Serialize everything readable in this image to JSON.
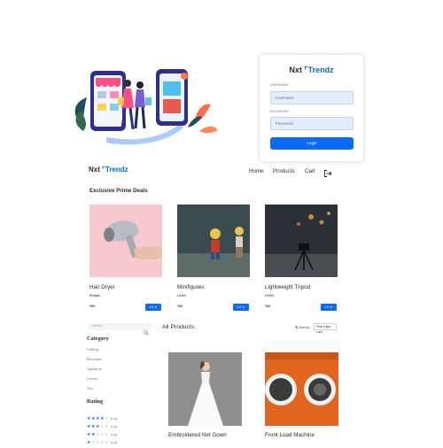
{
  "brand": {
    "prefix": "Nxt",
    "name": "Trendz"
  },
  "login": {
    "username_label": "USERNAME",
    "username_placeholder": "Username",
    "password_label": "PASSWORD",
    "password_placeholder": "Password",
    "button_label": "Login"
  },
  "nav": {
    "home": "Home",
    "products": "Products",
    "cart": "Cart"
  },
  "prime": {
    "title": "Exclusive Prime Deals",
    "items": [
      {
        "name": "Hair Dryer",
        "brand": "Philips",
        "price": "760",
        "rating": "3.6"
      },
      {
        "name": "Minifigures",
        "brand": "LEGO",
        "price": "760",
        "rating": "3.6"
      },
      {
        "name": "Lightweight Tripod",
        "brand": "LEGO",
        "price": "760",
        "rating": "3.6"
      }
    ]
  },
  "filters": {
    "search_placeholder": "Search",
    "category_title": "Category",
    "categories": [
      "Clothing",
      "Electronics",
      "Appliances",
      "Grocery",
      "Toys"
    ],
    "rating_title": "Rating",
    "ratings": [
      {
        "stars": 4,
        "label": "& up"
      },
      {
        "stars": 3,
        "label": "& up"
      },
      {
        "stars": 2,
        "label": "& up"
      },
      {
        "stars": 1,
        "label": "& up"
      }
    ]
  },
  "products": {
    "title": "All Products",
    "sort_label": "Sort by",
    "sort_value": "Price (High-Low)",
    "items": [
      {
        "name": "Embroidered Net Gown"
      },
      {
        "name": "Front Load Machine"
      }
    ]
  },
  "colors": {
    "accent": "#0b69ff",
    "brand_blue": "#0967d2",
    "text": "#1e293b"
  }
}
